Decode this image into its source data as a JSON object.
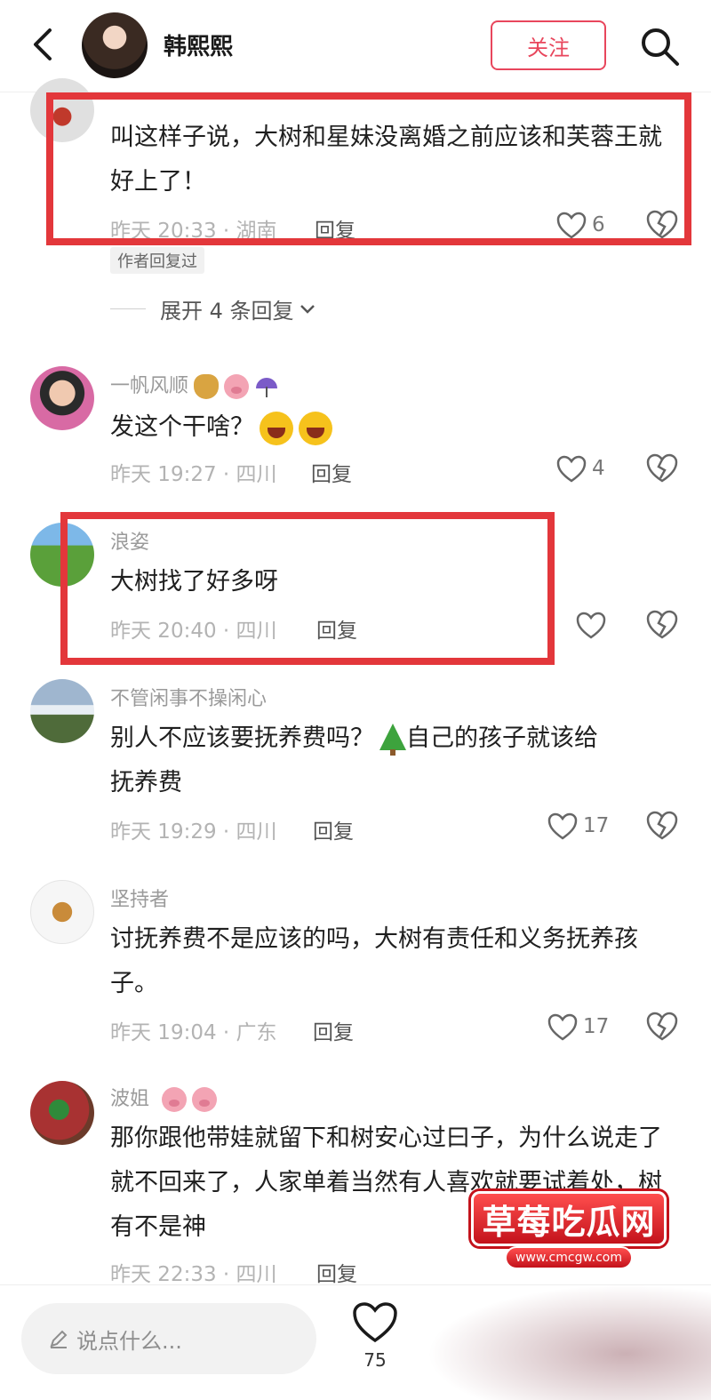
{
  "header": {
    "username": "韩熙熙",
    "follow_label": "关注"
  },
  "comments": [
    {
      "text": "叫这样子说，大树和星妹没离婚之前应该和芙蓉王就好上了！",
      "time": "昨天 20:33",
      "location": "湖南",
      "reply_label": "回复",
      "likes": "6",
      "author_tag": "作者回复过",
      "expand_label": "展开 4 条回复"
    },
    {
      "username": "一帆风顺",
      "text": "发这个干啥？",
      "time": "昨天 19:27",
      "location": "四川",
      "reply_label": "回复",
      "likes": "4"
    },
    {
      "username": "浪姿",
      "text": "大树找了好多呀",
      "time": "昨天 20:40",
      "location": "四川",
      "reply_label": "回复"
    },
    {
      "username": "不管闲事不操闲心",
      "text1": "别人不应该要抚养费吗？",
      "text2": "自己的孩子就该给",
      "text3": "抚养费",
      "time": "昨天 19:29",
      "location": "四川",
      "reply_label": "回复",
      "likes": "17"
    },
    {
      "username": "坚持者",
      "text": "讨抚养费不是应该的吗，大树有责任和义务抚养孩子。",
      "time": "昨天 19:04",
      "location": "广东",
      "reply_label": "回复",
      "likes": "17"
    },
    {
      "username": "波姐",
      "text": "那你跟他带娃就留下和树安心过曰子，为什么说走了就不回来了，人家单着当然有人喜欢就要试着处，树有不是神",
      "time": "昨天 22:33",
      "location": "四川",
      "reply_label": "回复"
    }
  ],
  "bottom": {
    "input_placeholder": "说点什么...",
    "like_count": "75"
  },
  "watermark": {
    "title": "草莓吃瓜网",
    "url": "www.cmcgw.com"
  },
  "colors": {
    "accent": "#e8465c",
    "highlight": "#e3373b"
  }
}
